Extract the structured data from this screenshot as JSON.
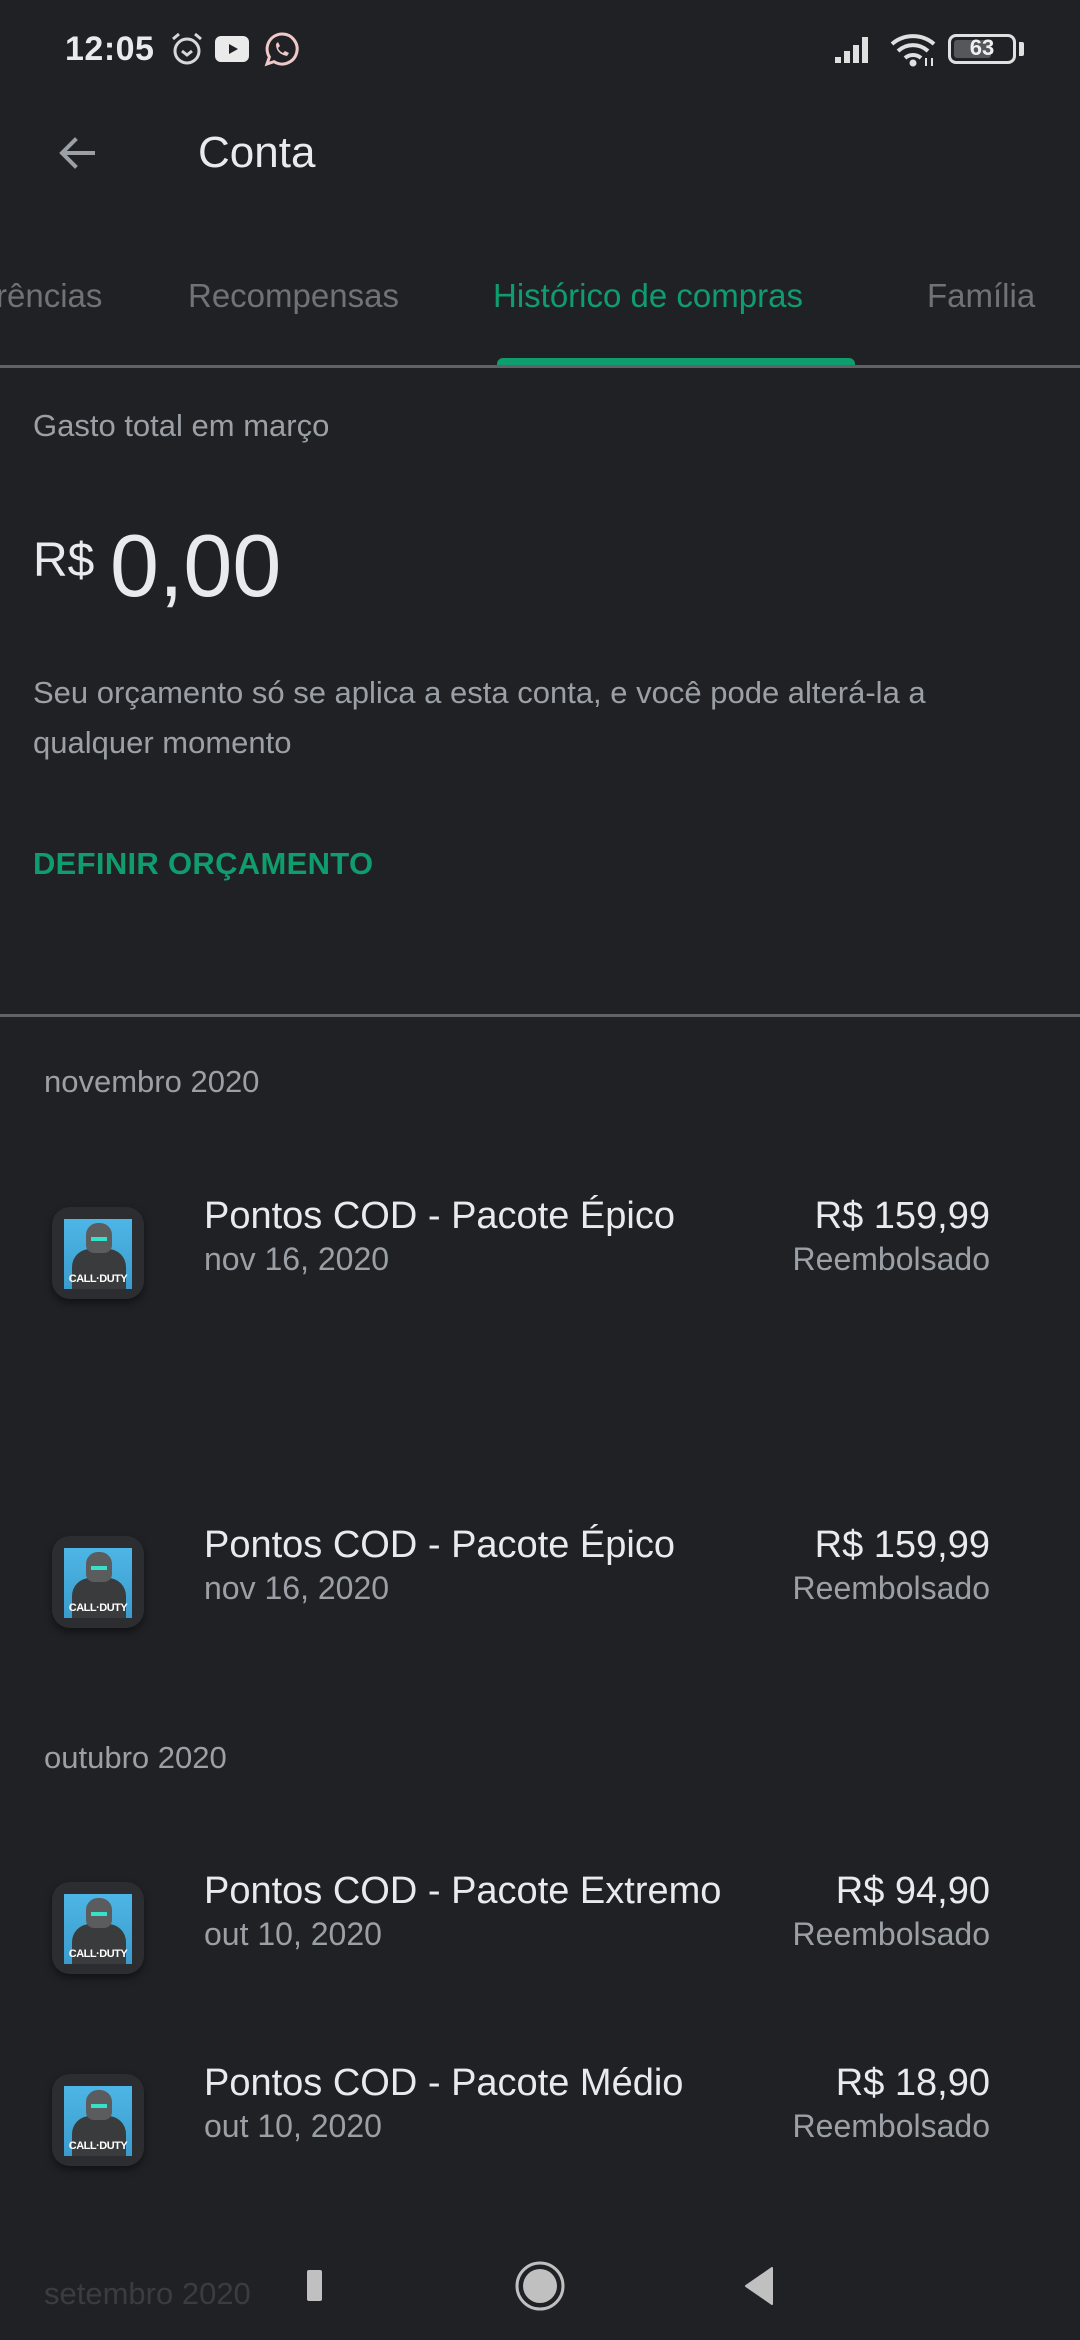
{
  "status_bar": {
    "time": "12:05",
    "notification_icons": [
      "alarm-icon",
      "youtube-icon",
      "whatsapp-icon"
    ],
    "system_icons": [
      "signal-icon",
      "wifi-icon",
      "battery-icon"
    ],
    "battery_level": "63"
  },
  "app_bar": {
    "back_icon": "arrow-back-icon",
    "title": "Conta"
  },
  "tabs": {
    "items": [
      {
        "label": "rências",
        "active": false
      },
      {
        "label": "Recompensas",
        "active": false
      },
      {
        "label": "Histórico de compras",
        "active": true
      },
      {
        "label": "Família",
        "active": false
      }
    ]
  },
  "budget": {
    "label": "Gasto total em março",
    "currency": "R$",
    "amount": "0,00",
    "description": "Seu orçamento só se aplica a esta conta, e você pode alterá-la a qualquer momento",
    "action_label": "DEFINIR ORÇAMENTO"
  },
  "history": {
    "groups": [
      {
        "month": "novembro 2020",
        "items": [
          {
            "title": "Pontos COD - Pacote Épico",
            "date": "nov 16, 2020",
            "price": "R$ 159,99",
            "status": "Reembolsado",
            "app_icon_text": "CALL·DUTY"
          },
          {
            "title": "Pontos COD - Pacote Épico",
            "date": "nov 16, 2020",
            "price": "R$ 159,99",
            "status": "Reembolsado",
            "app_icon_text": "CALL·DUTY"
          }
        ]
      },
      {
        "month": "outubro 2020",
        "items": [
          {
            "title": "Pontos COD - Pacote Extremo",
            "date": "out 10, 2020",
            "price": "R$ 94,90",
            "status": "Reembolsado",
            "app_icon_text": "CALL·DUTY"
          },
          {
            "title": "Pontos COD - Pacote Médio",
            "date": "out 10, 2020",
            "price": "R$ 18,90",
            "status": "Reembolsado",
            "app_icon_text": "CALL·DUTY"
          }
        ]
      },
      {
        "month": "setembro 2020",
        "items": []
      }
    ]
  },
  "nav_bar": {
    "buttons": [
      "recents-icon",
      "home-icon",
      "back-icon"
    ]
  },
  "colors": {
    "background": "#202124",
    "accent": "#0f9d6e",
    "text_primary": "#e8eaed",
    "text_secondary": "#9aa0a6",
    "tab_inactive": "#6f7276",
    "divider": "#5f6266"
  }
}
